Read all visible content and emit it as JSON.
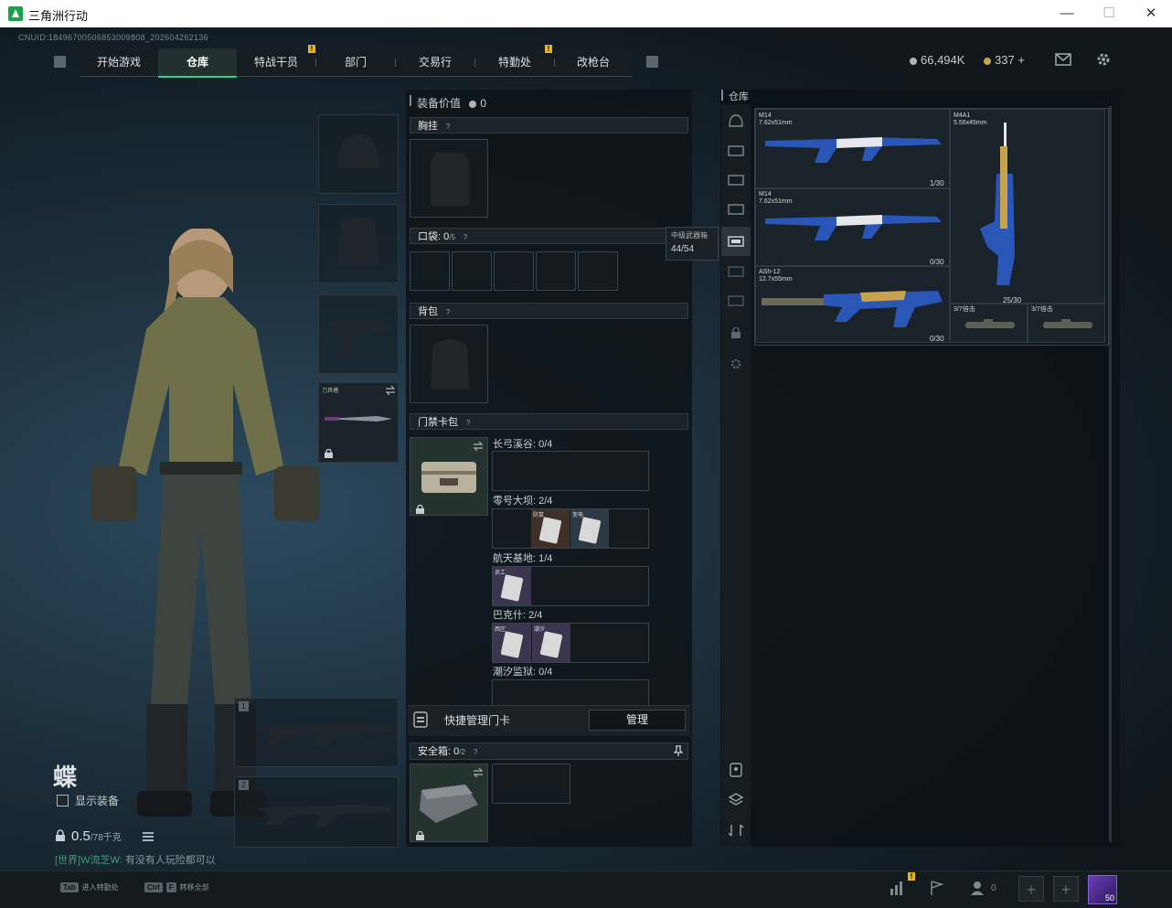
{
  "window": {
    "title": "三角洲行动",
    "minimize": "—",
    "maximize": "☐",
    "close": "✕"
  },
  "cnuid": "CNUID:18496700506853009808_202604262136",
  "nav": {
    "tabs": [
      {
        "label": "开始游戏"
      },
      {
        "label": "仓库",
        "active": true
      },
      {
        "label": "特战干员",
        "badge": "!"
      },
      {
        "label": "部门"
      },
      {
        "label": "交易行"
      },
      {
        "label": "特勤处",
        "badge": "!"
      },
      {
        "label": "改枪台"
      }
    ]
  },
  "currency": {
    "coins": "66,494K",
    "gold": "337",
    "plus": "+"
  },
  "character": {
    "name": "蝶",
    "show_equipment": "显示装备",
    "weight": "0.5",
    "weight_max": "/78千克",
    "chat_channel": "[世界]",
    "chat_user": "W流芝W:",
    "chat_msg": "有没有人玩险都可以"
  },
  "equipment": {
    "value_label": "装备价值",
    "value": "0",
    "chest_rig": "胸挂",
    "pockets_label": "口袋:",
    "pockets_count": "0",
    "pockets_max": "/5",
    "backpack": "背包",
    "keycard": "门禁卡包",
    "melee_slot": "刀具槽",
    "weapon_slot_1": "1",
    "weapon_slot_2": "2"
  },
  "keycard_zones": [
    {
      "label": "长弓溪谷: 0/4",
      "filled": 0
    },
    {
      "label": "零号大坝: 2/4",
      "filled": 2,
      "cards": [
        "防鼠",
        "变电"
      ]
    },
    {
      "label": "航天基地: 1/4",
      "filled": 1,
      "cards": [
        "员工"
      ]
    },
    {
      "label": "巴克什: 2/4",
      "filled": 2,
      "cards": [
        "西区",
        "潮汐"
      ]
    },
    {
      "label": "潮汐监狱: 0/4",
      "filled": 0
    }
  ],
  "quick_manage": {
    "label": "快捷管理门卡",
    "button": "管理"
  },
  "safe_box": {
    "label": "安全箱:",
    "count": "0",
    "max": "/2"
  },
  "tooltip": {
    "title": "中级武器箱",
    "value": "44/54"
  },
  "warehouse": {
    "title": "仓库",
    "guns": [
      {
        "name": "M14",
        "caliber": "7.62x51mm",
        "ammo": "1/30"
      },
      {
        "name": "M14",
        "caliber": "7.62x51mm",
        "ammo": "0/30"
      },
      {
        "name": "ASh-12",
        "caliber": "12.7x55mm",
        "ammo": "0/30"
      },
      {
        "name": "M4A1",
        "caliber": "5.56x45mm",
        "ammo": "25/30"
      }
    ],
    "scopes": [
      {
        "label": "3/7倍击"
      },
      {
        "label": "3/7倍击"
      }
    ]
  },
  "bottom": {
    "tab_key": "Tab",
    "tab_action": "进入特勤处",
    "ctrl_key": "Ctrl",
    "f_key": "F",
    "ctrl_action": "转移全部",
    "friends_count": "0",
    "avatar_level": "50"
  },
  "colors": {
    "accent": "#2fd48d",
    "badge": "#e3b328",
    "gun_blue": "#2a56b8"
  }
}
